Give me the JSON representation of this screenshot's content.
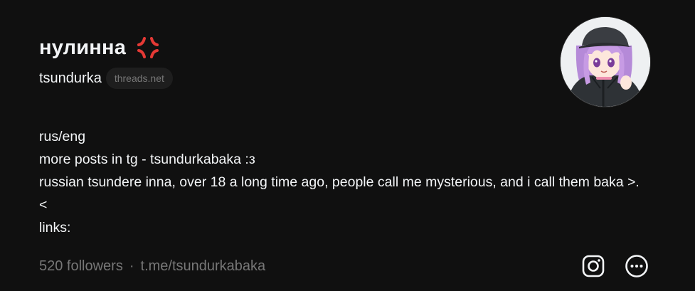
{
  "profile": {
    "display_name": "нулинна",
    "status_emoji_icon": "anger-symbol-icon",
    "username": "tsundurka",
    "domain_badge": "threads.net",
    "avatar_alt": "anime girl avatar",
    "bio": [
      "rus/eng",
      "more posts in tg - tsundurkabaka :з",
      "russian tsundere inna, over 18 a long time ago, people call me mysterious, and i call them baka >.<",
      "links:"
    ],
    "followers": "520 followers",
    "separator": "·",
    "link": "t.me/tsundurkabaka",
    "actions": {
      "instagram_icon": "instagram-icon",
      "more_icon": "more-options-icon"
    }
  },
  "colors": {
    "background": "#101010",
    "text_primary": "#f3f5f7",
    "text_secondary": "#777777",
    "badge_bg": "#1e1e1e",
    "anger_red": "#e53935"
  }
}
